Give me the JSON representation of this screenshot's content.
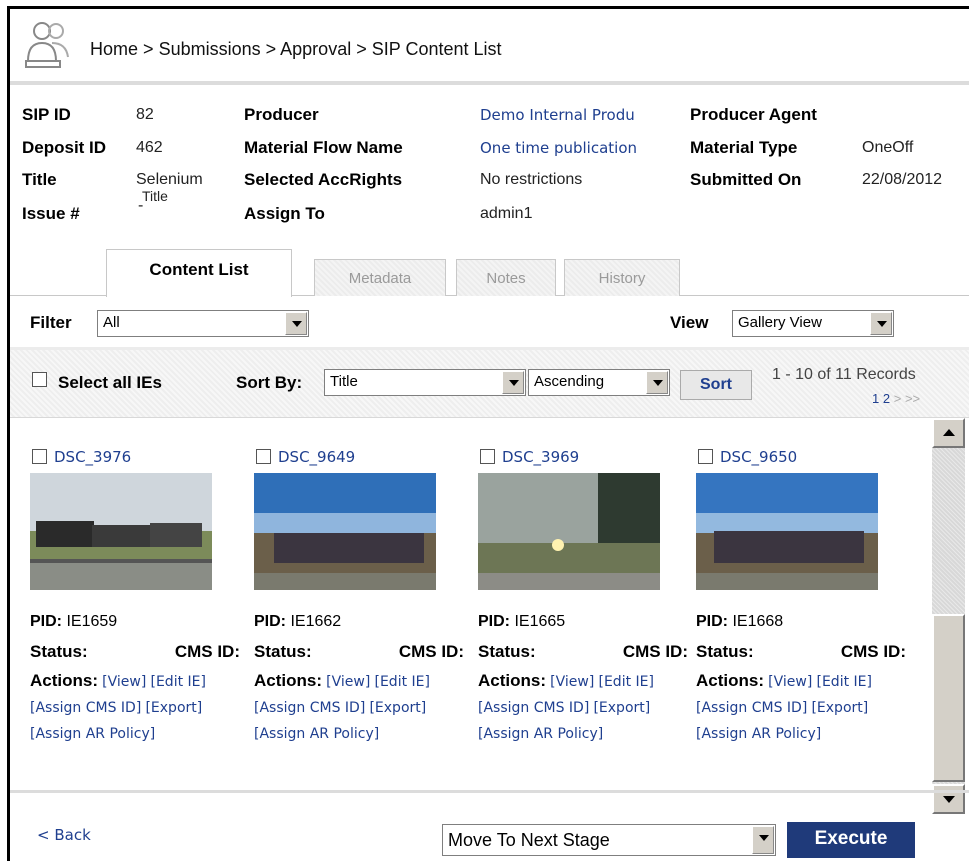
{
  "breadcrumb": {
    "home": "Home",
    "sep": ">",
    "submissions": "Submissions",
    "approval": "Approval",
    "current": "SIP Content List"
  },
  "info": {
    "sip_id_label": "SIP ID",
    "sip_id": "82",
    "deposit_id_label": "Deposit ID",
    "deposit_id": "462",
    "title_label": "Title",
    "title_line1": "Selenium",
    "title_line2": "Title",
    "issue_label": "Issue #",
    "issue": "-",
    "producer_label": "Producer",
    "producer": "Demo Internal Produ",
    "material_flow_label": "Material Flow Name",
    "material_flow": "One time publication",
    "acc_rights_label": "Selected AccRights",
    "acc_rights": "No restrictions",
    "assign_to_label": "Assign To",
    "assign_to": "admin1",
    "producer_agent_label": "Producer Agent",
    "material_type_label": "Material Type",
    "material_type": "OneOff",
    "submitted_on_label": "Submitted On",
    "submitted_on": "22/08/2012"
  },
  "tabs": [
    "Content List",
    "Metadata",
    "Notes",
    "History"
  ],
  "filter": {
    "label": "Filter",
    "value": "All"
  },
  "view": {
    "label": "View",
    "value": "Gallery View"
  },
  "sort": {
    "select_all": "Select all IEs",
    "sort_by_label": "Sort By:",
    "field": "Title",
    "order": "Ascending",
    "button": "Sort",
    "records": "1 - 10 of 11 Records",
    "page_1": "1",
    "page_2": "2",
    "next": ">",
    "last": ">>"
  },
  "items": [
    {
      "title": "DSC_3976",
      "pid_label": "PID:",
      "pid": "IE1659",
      "status_label": "Status:",
      "cms_label": "CMS ID:",
      "actions_label": "Actions:",
      "view": "[View]",
      "edit": "[Edit IE]",
      "assign_cms": "[Assign CMS ID]",
      "export": "[Export]",
      "assign_ar": "[Assign AR Policy]"
    },
    {
      "title": "DSC_9649",
      "pid_label": "PID:",
      "pid": "IE1662",
      "status_label": "Status:",
      "cms_label": "CMS ID:",
      "actions_label": "Actions:",
      "view": "[View]",
      "edit": "[Edit IE]",
      "assign_cms": "[Assign CMS ID]",
      "export": "[Export]",
      "assign_ar": "[Assign AR Policy]"
    },
    {
      "title": "DSC_3969",
      "pid_label": "PID:",
      "pid": "IE1665",
      "status_label": "Status:",
      "cms_label": "CMS ID:",
      "actions_label": "Actions:",
      "view": "[View]",
      "edit": "[Edit IE]",
      "assign_cms": "[Assign CMS ID]",
      "export": "[Export]",
      "assign_ar": "[Assign AR Policy]"
    },
    {
      "title": "DSC_9650",
      "pid_label": "PID:",
      "pid": "IE1668",
      "status_label": "Status:",
      "cms_label": "CMS ID:",
      "actions_label": "Actions:",
      "view": "[View]",
      "edit": "[Edit IE]",
      "assign_cms": "[Assign CMS ID]",
      "export": "[Export]",
      "assign_ar": "[Assign AR Policy]"
    }
  ],
  "bottom": {
    "back": "< Back",
    "action": "Move To Next Stage",
    "execute": "Execute"
  },
  "colors": {
    "link": "#1f3f8f",
    "execute_bg": "#1f3a7a"
  },
  "icons": [
    "users-icon",
    "chevron-down-icon",
    "scroll-up-icon",
    "scroll-down-icon"
  ]
}
